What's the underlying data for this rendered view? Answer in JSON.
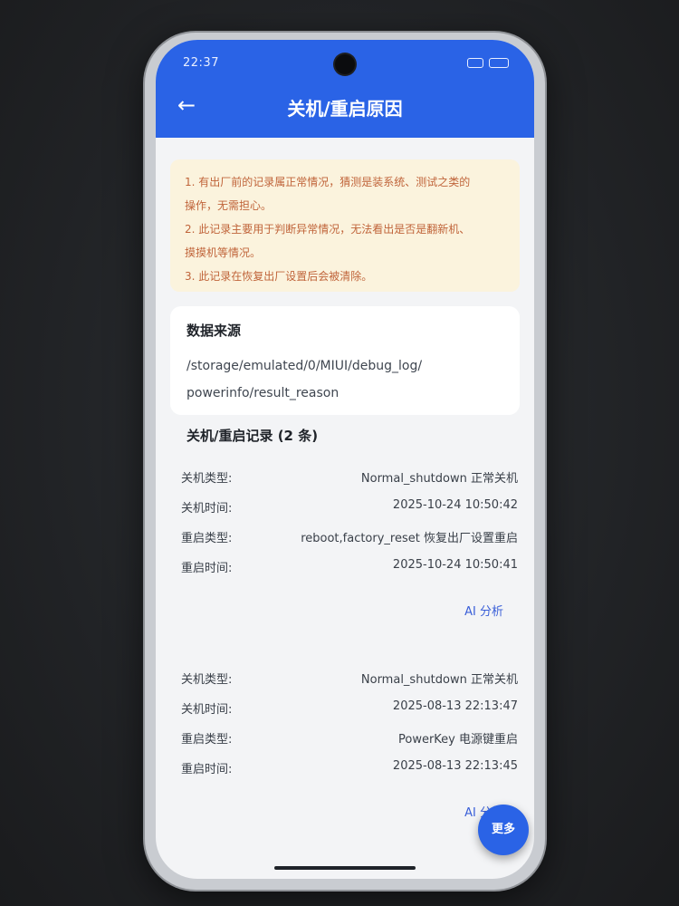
{
  "status_bar": {
    "time": "22:37"
  },
  "header": {
    "back_icon": "arrow-left-icon",
    "title": "关机/重启原因"
  },
  "notice": {
    "lines": [
      "1. 有出厂前的记录属正常情况，猜测是装系统、测试之类的",
      "操作，无需担心。",
      "2. 此记录主要用于判断异常情况，无法看出是否是翻新机、",
      "摸摸机等情况。",
      "3. 此记录在恢复出厂设置后会被清除。"
    ]
  },
  "source": {
    "title": "数据来源",
    "path_lines": [
      "/storage/emulated/0/MIUI/debug_log/",
      "powerinfo/result_reason"
    ]
  },
  "records": {
    "title": "关机/重启记录 (2 条)",
    "items": [
      {
        "fields": [
          {
            "label": "关机类型:",
            "value": "Normal_shutdown 正常关机"
          },
          {
            "label": "关机时间:",
            "value": "2025-10-24 10:50:42"
          },
          {
            "label": "重启类型:",
            "value": "reboot,factory_reset 恢复出厂设置重启"
          },
          {
            "label": "重启时间:",
            "value": "2025-10-24 10:50:41"
          }
        ],
        "ai_label": "AI 分析"
      },
      {
        "fields": [
          {
            "label": "关机类型:",
            "value": "Normal_shutdown 正常关机"
          },
          {
            "label": "关机时间:",
            "value": "2025-08-13 22:13:47"
          },
          {
            "label": "重启类型:",
            "value": "PowerKey 电源键重启"
          },
          {
            "label": "重启时间:",
            "value": "2025-08-13 22:13:45"
          }
        ],
        "ai_label": "AI 分析"
      }
    ]
  },
  "fab": {
    "label": "更多"
  },
  "colors": {
    "accent": "#2a63e6",
    "notice_bg": "#fbf3dd",
    "notice_text": "#c0643a",
    "link": "#3a5fd8"
  }
}
